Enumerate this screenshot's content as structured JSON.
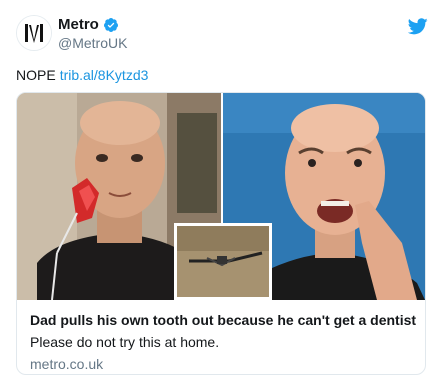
{
  "account": {
    "name": "Metro",
    "handle": "@MetroUK",
    "verified": true
  },
  "tweet": {
    "text": "NOPE",
    "link": "trib.al/8Kytzd3"
  },
  "card": {
    "title": "Dad pulls his own tooth out because he can't get a dentist i...",
    "description": "Please do not try this at home.",
    "domain": "metro.co.uk"
  },
  "colors": {
    "twitter_blue": "#1da1f2",
    "link": "#1b95e0",
    "muted": "#657786",
    "text": "#14171a"
  },
  "icons": {
    "brand": "twitter-bird-icon",
    "verified": "verified-badge-icon",
    "avatar": "metro-logo"
  }
}
